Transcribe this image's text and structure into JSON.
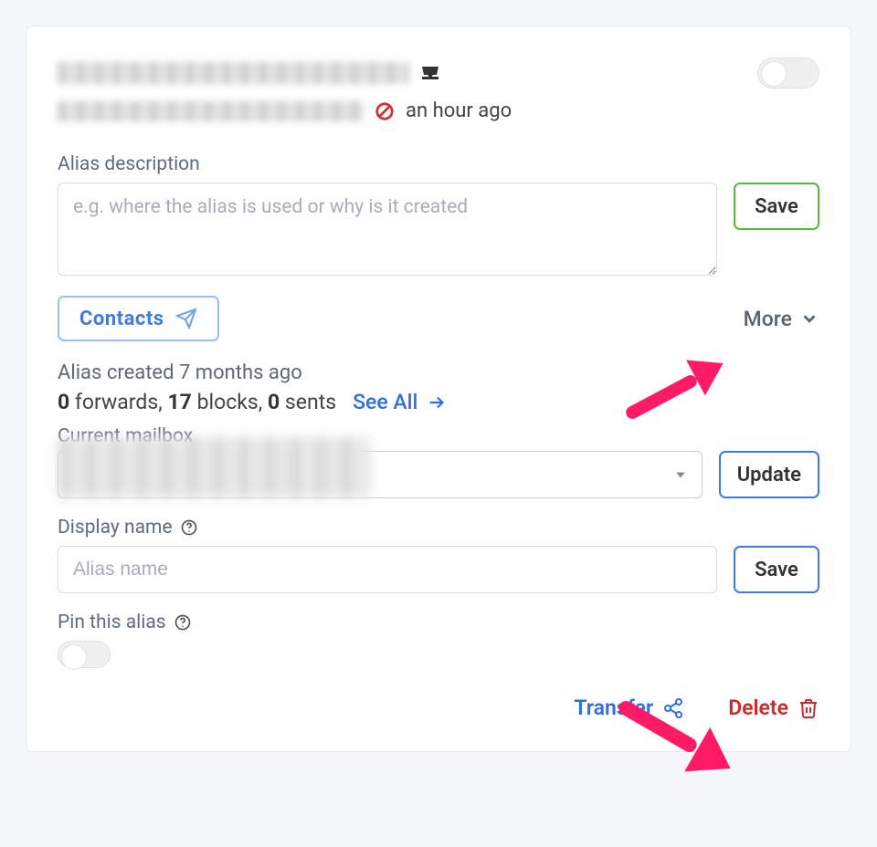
{
  "alias": {
    "last_activity": "an hour ago",
    "enabled": false
  },
  "description": {
    "label": "Alias description",
    "placeholder": "e.g. where the alias is used or why is it created",
    "save_label": "Save"
  },
  "contacts": {
    "label": "Contacts"
  },
  "more_label": "More",
  "meta": {
    "created": "Alias created 7 months ago",
    "forwards": 0,
    "blocks": 17,
    "sents": 0,
    "seeall": "See All"
  },
  "mailbox": {
    "label": "Current mailbox",
    "update_label": "Update"
  },
  "displayname": {
    "label": "Display name",
    "placeholder": "Alias name",
    "save_label": "Save"
  },
  "pin": {
    "label": "Pin this alias",
    "enabled": false
  },
  "actions": {
    "transfer": "Transfer",
    "delete": "Delete"
  }
}
